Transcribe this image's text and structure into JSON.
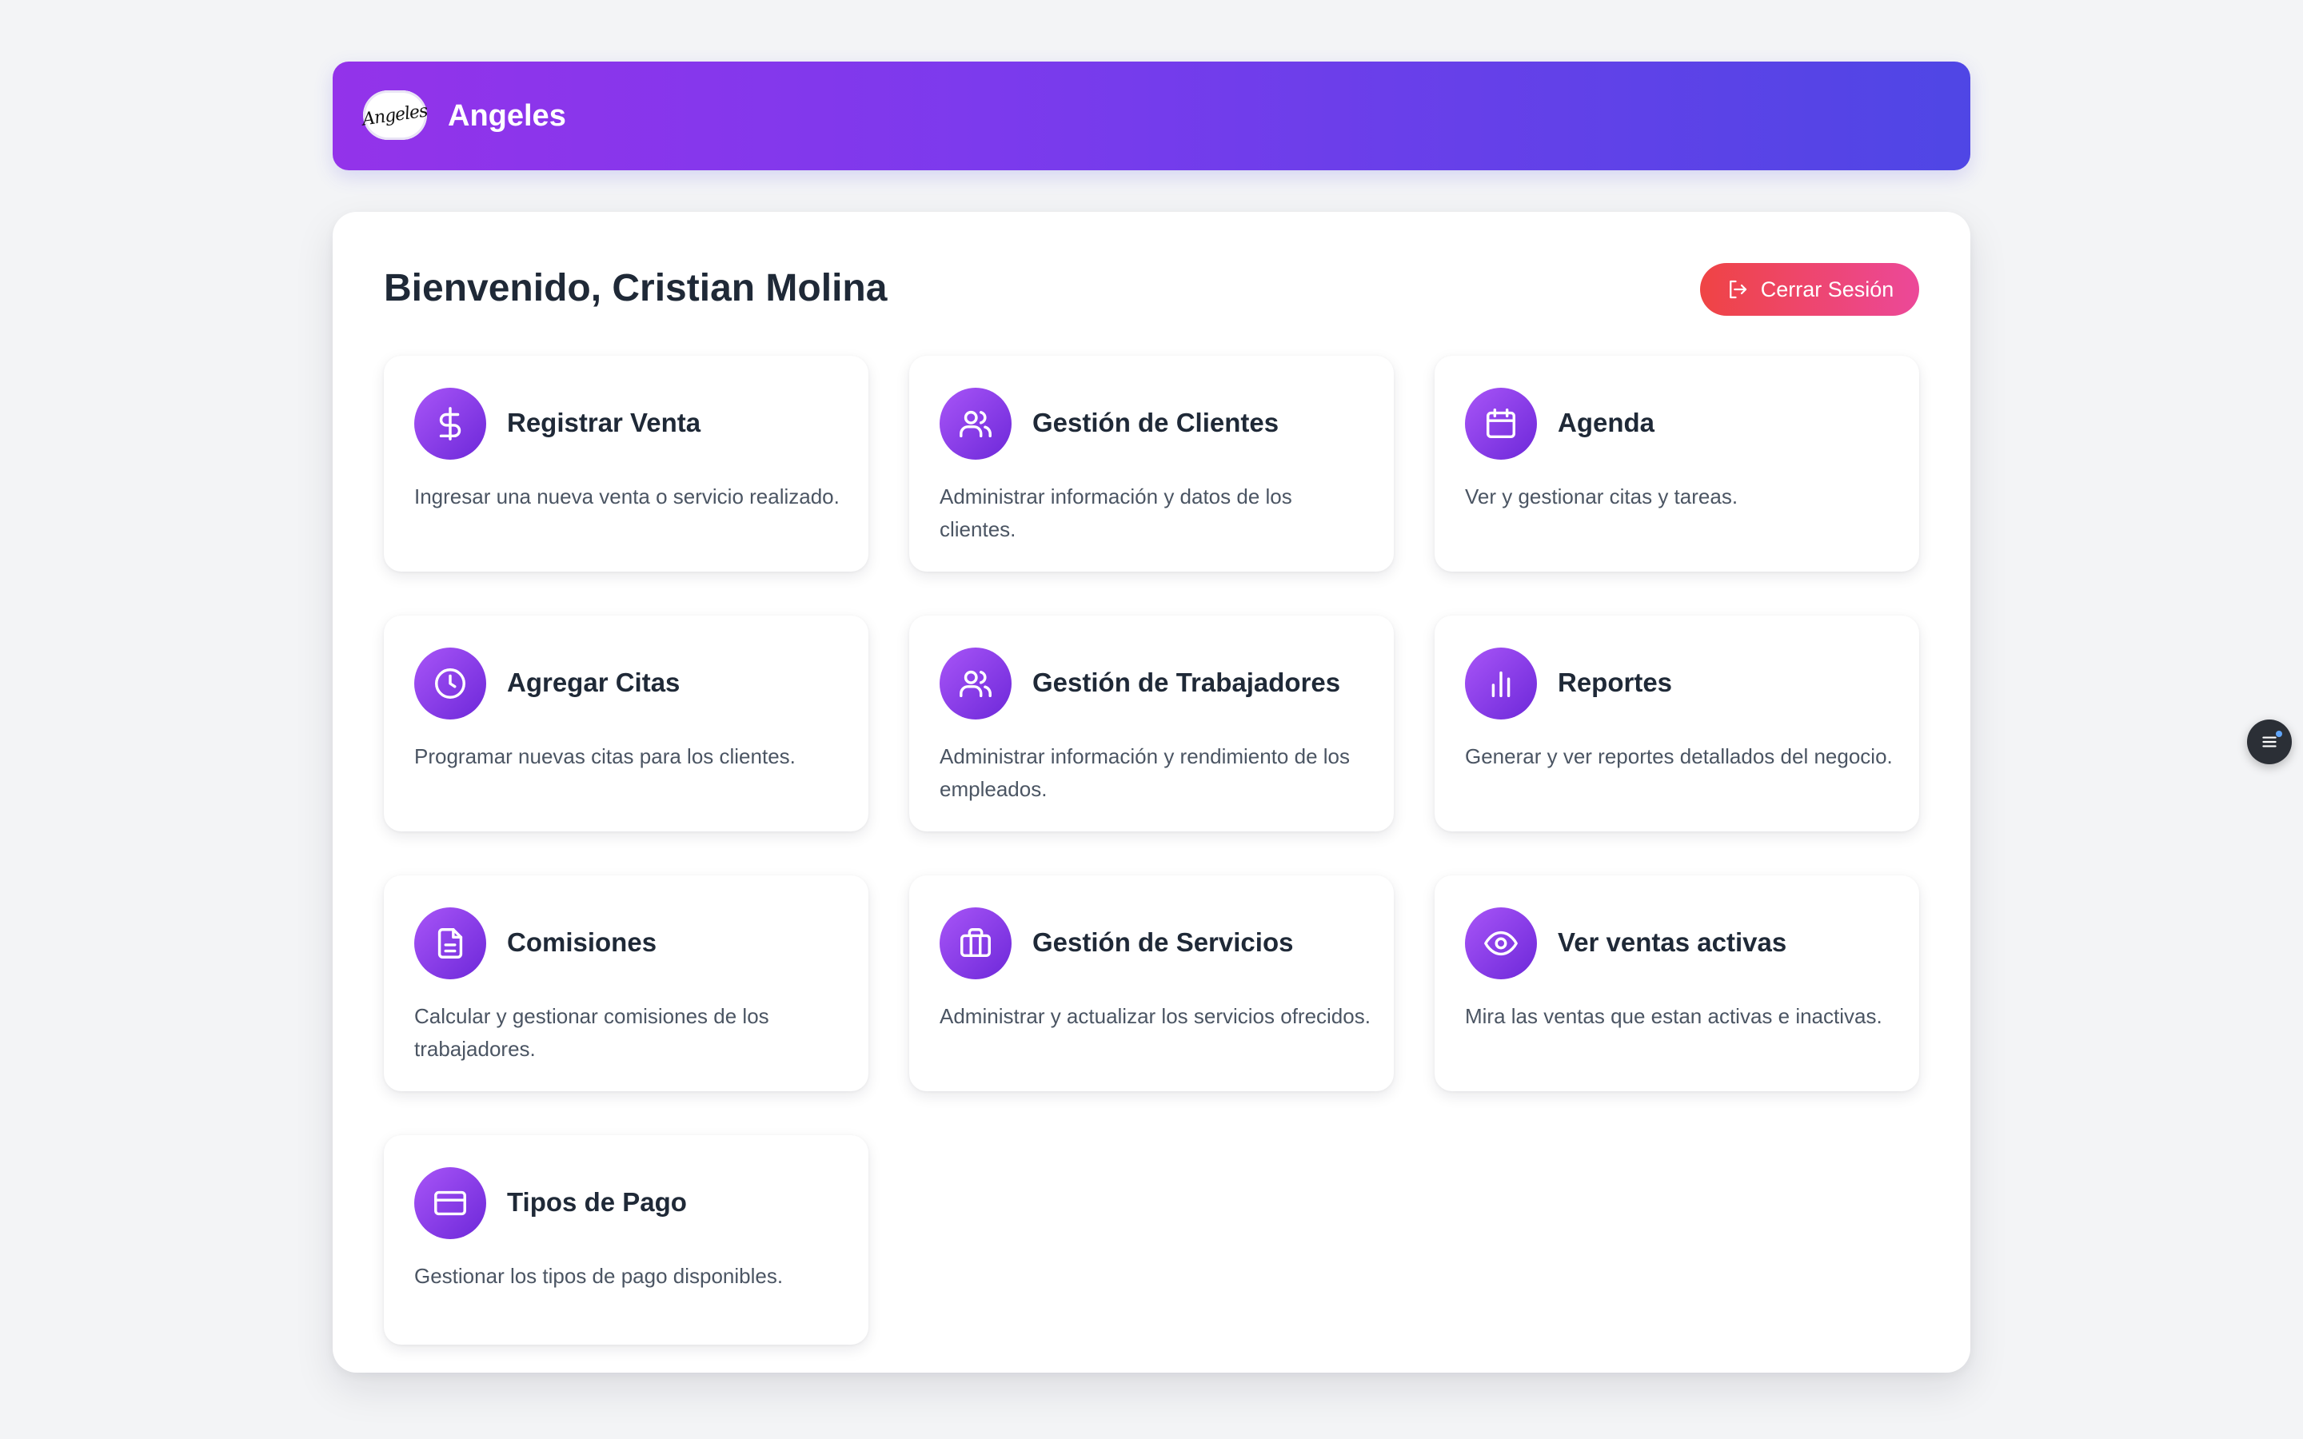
{
  "header": {
    "logo_text": "Angeles",
    "brand": "Angeles",
    "gradient": [
      "#9333ea",
      "#4f46e5"
    ]
  },
  "main": {
    "welcome": "Bienvenido, Cristian Molina",
    "logout_label": "Cerrar Sesión",
    "logout_colors": [
      "#ef4444",
      "#ec4899"
    ]
  },
  "cards": [
    {
      "icon": "dollar-icon",
      "title": "Registrar Venta",
      "desc": "Ingresar una nueva venta o servicio realizado."
    },
    {
      "icon": "users-icon",
      "title": "Gestión de Clientes",
      "desc": "Administrar información y datos de los clientes."
    },
    {
      "icon": "calendar-icon",
      "title": "Agenda",
      "desc": "Ver y gestionar citas y tareas."
    },
    {
      "icon": "clock-icon",
      "title": "Agregar Citas",
      "desc": "Programar nuevas citas para los clientes."
    },
    {
      "icon": "users-icon",
      "title": "Gestión de Trabajadores",
      "desc": "Administrar información y rendimiento de los empleados."
    },
    {
      "icon": "bar-chart-icon",
      "title": "Reportes",
      "desc": "Generar y ver reportes detallados del negocio."
    },
    {
      "icon": "document-icon",
      "title": "Comisiones",
      "desc": "Calcular y gestionar comisiones de los trabajadores."
    },
    {
      "icon": "briefcase-icon",
      "title": "Gestión de Servicios",
      "desc": "Administrar y actualizar los servicios ofrecidos."
    },
    {
      "icon": "eye-icon",
      "title": "Ver ventas activas",
      "desc": "Mira las ventas que estan activas e inactivas."
    },
    {
      "icon": "credit-card-icon",
      "title": "Tipos de Pago",
      "desc": "Gestionar los tipos de pago disponibles."
    }
  ],
  "accent_color": "#7c3aed"
}
